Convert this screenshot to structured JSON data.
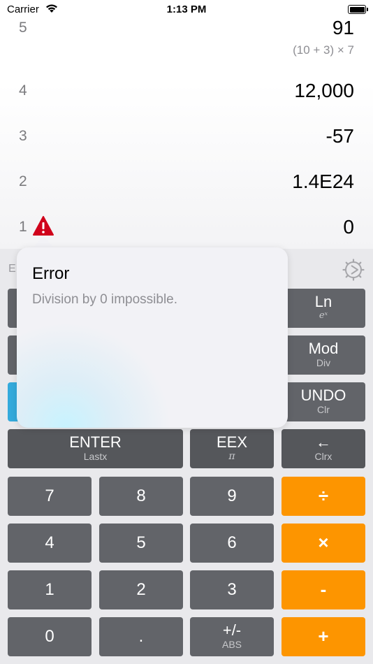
{
  "status_bar": {
    "carrier": "Carrier",
    "time": "1:13 PM"
  },
  "stack": [
    {
      "index": "5",
      "value": "91",
      "expression": "(10 + 3) × 7"
    },
    {
      "index": "4",
      "value": "12,000"
    },
    {
      "index": "3",
      "value": "-57"
    },
    {
      "index": "2",
      "value": "1.4E24"
    },
    {
      "index": "1",
      "value": "0"
    }
  ],
  "info_letter": "E",
  "error_popover": {
    "title": "Error",
    "message": "Division by 0 impossible."
  },
  "keys": {
    "ln": {
      "main": "Ln",
      "sub": "eˣ"
    },
    "mod": {
      "main": "Mod",
      "sub": "Div"
    },
    "undo": {
      "main": "UNDO",
      "sub": "Clr"
    },
    "enter": {
      "main": "ENTER",
      "sub": "Lastx"
    },
    "eex": {
      "main": "EEX",
      "sub": "π"
    },
    "backspace": {
      "main": "←",
      "sub": "Clrx"
    },
    "seven": "7",
    "eight": "8",
    "nine": "9",
    "divide": "÷",
    "four": "4",
    "five": "5",
    "six": "6",
    "multiply": "×",
    "one": "1",
    "two": "2",
    "three": "3",
    "minus": "-",
    "zero": "0",
    "decimal": ".",
    "sign": {
      "main": "+/-",
      "sub": "ABS"
    },
    "plus": "+"
  },
  "colors": {
    "operator_orange": "#fd9500",
    "key_gray": "#626469",
    "accent_blue": "#34aadc",
    "warning_red": "#d0021b"
  },
  "icons": {
    "warning": "warning-triangle-icon",
    "settings": "gear-icon",
    "wifi": "wifi-icon",
    "battery": "battery-icon"
  }
}
